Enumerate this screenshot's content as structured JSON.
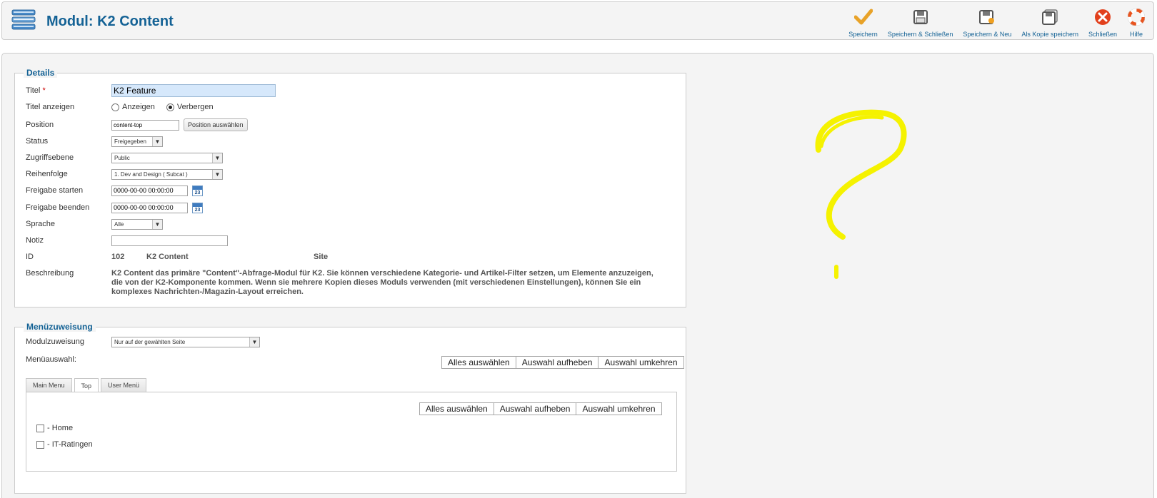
{
  "header": {
    "title": "Modul: K2 Content",
    "toolbar": [
      {
        "label": "Speichern",
        "icon": "check-icon",
        "color": "#e8a228"
      },
      {
        "label": "Speichern & Schließen",
        "icon": "save-close-icon",
        "color": "#555555"
      },
      {
        "label": "Speichern & Neu",
        "icon": "save-new-icon",
        "color": "#555555"
      },
      {
        "label": "Als Kopie speichern",
        "icon": "save-copy-icon",
        "color": "#555555"
      },
      {
        "label": "Schließen",
        "icon": "close-icon",
        "color": "#e2401c"
      },
      {
        "label": "Hilfe",
        "icon": "help-icon",
        "color": "#e9531d"
      }
    ]
  },
  "details": {
    "legend": "Details",
    "title_label": "Titel",
    "title_required": "*",
    "title_value": "K2 Feature",
    "show_title_label": "Titel anzeigen",
    "show_option": "Anzeigen",
    "hide_option": "Verbergen",
    "show_title_selected": "Verbergen",
    "position_label": "Position",
    "position_value": "content-top",
    "position_button": "Position auswählen",
    "status_label": "Status",
    "status_value": "Freigegeben",
    "access_label": "Zugriffsebene",
    "access_value": "Public",
    "order_label": "Reihenfolge",
    "order_value": "1. Dev and Design ( Subcat )",
    "publish_up_label": "Freigabe starten",
    "publish_up_value": "0000-00-00 00:00:00",
    "publish_down_label": "Freigabe beenden",
    "publish_down_value": "0000-00-00 00:00:00",
    "calendar_day": "23",
    "language_label": "Sprache",
    "language_value": "Alle",
    "note_label": "Notiz",
    "note_value": "",
    "id_label": "ID",
    "id_value": "102",
    "module_type": "K2 Content",
    "client": "Site",
    "description_label": "Beschreibung",
    "description": "K2 Content das primäre \"Content\"-Abfrage-Modul für K2. Sie können verschiedene Kategorie- und Artikel-Filter setzen, um Elemente anzuzeigen, die von der K2-Komponente kommen. Wenn sie mehrere Kopien dieses Moduls verwenden (mit verschiedenen Einstellungen), können Sie ein komplexes Nachrichten-/Magazin-Layout erreichen."
  },
  "menu_assignment": {
    "legend": "Menüzuweisung",
    "assign_label": "Modulzuweisung",
    "assign_value": "Nur auf der gewählten Seite",
    "selection_label": "Menüauswahl:",
    "select_all": "Alles auswählen",
    "deselect": "Auswahl aufheben",
    "invert": "Auswahl umkehren",
    "tabs": [
      "Main Menu",
      "Top",
      "User Menü"
    ],
    "active_tab": "Top",
    "items": [
      {
        "label": "- Home",
        "checked": false
      },
      {
        "label": "- IT-Ratingen",
        "checked": false
      }
    ]
  },
  "annotation": {
    "color": "#f5f200"
  }
}
